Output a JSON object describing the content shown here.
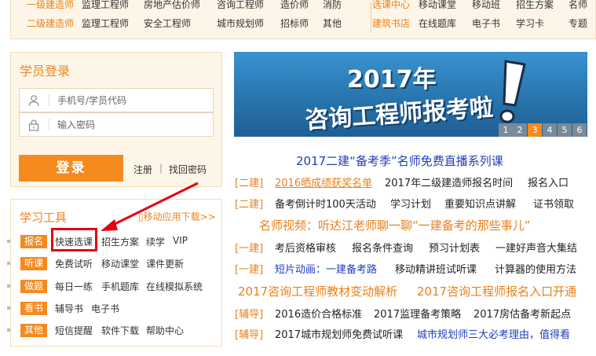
{
  "top_nav": {
    "row1": [
      "一级建造师",
      "监理工程师",
      "房地产估价师",
      "咨询工程师",
      "造价师",
      "消防",
      "选课中心",
      "移动课堂",
      "移动班",
      "招生方案",
      "名师"
    ],
    "row2": [
      "二级建造师",
      "监理工程师",
      "安全工程师",
      "城市规划师",
      "招标师",
      "其他",
      "建筑书店",
      "在线题库",
      "电子书",
      "学习卡",
      "专题"
    ]
  },
  "login": {
    "title": "学员登录",
    "username_placeholder": "手机号/学员代码",
    "password_placeholder": "输入密码",
    "login_button": "登录",
    "register_link": "注册",
    "divider": "|",
    "forgot_link": "找回密码"
  },
  "tools": {
    "title": "学习工具",
    "mobile_link": "移动应用下载>>",
    "rows": [
      {
        "tag": "报名",
        "items": [
          "快速选课",
          "招生方案",
          "续学",
          "VIP"
        ]
      },
      {
        "tag": "听课",
        "items": [
          "免费试听",
          "移动课堂",
          "课件更新"
        ]
      },
      {
        "tag": "做题",
        "items": [
          "每日一练",
          "手机题库",
          "在线模拟系统"
        ]
      },
      {
        "tag": "看书",
        "items": [
          "辅导书",
          "电子书"
        ]
      },
      {
        "tag": "其他",
        "items": [
          "短信提醒",
          "软件下载",
          "帮助中心"
        ]
      }
    ]
  },
  "banner": {
    "year": "2017年",
    "headline": "咨询工程师报考啦",
    "exclamation": "!",
    "pages": [
      "1",
      "2",
      "3",
      "4",
      "5",
      "6"
    ],
    "active_page": "3"
  },
  "news": {
    "headline1": "2017二建“备考季”名师免费直播系列课",
    "line1": {
      "tag": "[二建]",
      "items": [
        "2016晒成绩获奖名单",
        "2017年二级建造师报名时间",
        "报名入口"
      ]
    },
    "line2": {
      "tag": "[二建]",
      "items": [
        "备考倒计时100天活动",
        "学习计划",
        "重要知识点讲解",
        "证书领取"
      ]
    },
    "headline2": "名师视频：听达江老师聊一聊“一建备考的那些事儿”",
    "line3": {
      "tag": "[一建]",
      "items": [
        "考后资格审核",
        "报名条件查询",
        "预习计划表",
        "一建好声音大集结"
      ]
    },
    "line4": {
      "tag": "[一建]",
      "items": [
        "短片动画：一建备考路",
        "移动精讲班试听课",
        "计算器的使用方法"
      ]
    },
    "headline3a": "2017咨询工程师教材变动解析",
    "headline3b": "2017咨询工程师报名入口开通",
    "line5": {
      "tag": "[辅导]",
      "items": [
        "2016造价合格标准",
        "2017监理备考策略",
        "2017房估备考新起点"
      ]
    },
    "line6": {
      "tag": "[辅导]",
      "items": [
        "2017城市规划师免费试听课",
        "城市规划师三大必考理由，值得看"
      ]
    }
  },
  "colors": {
    "accent": "#f58a1f",
    "link_blue": "#1f3fb8",
    "highlight_red": "#e60012",
    "banner_blue": "#2d7bb6"
  }
}
